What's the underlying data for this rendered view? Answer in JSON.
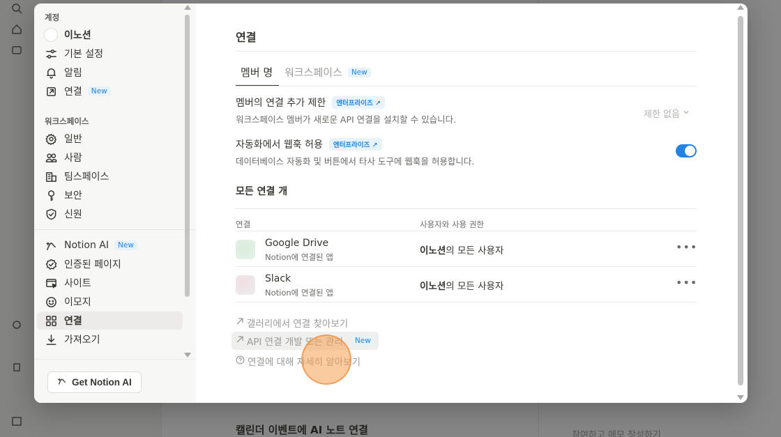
{
  "background": {
    "bottom_text": "캘린더 이벤트에 AI 노트 연결",
    "bottom_right_text": "참여하고 메모 작성하기"
  },
  "sidebar": {
    "account_section": "계정",
    "account_items": [
      {
        "label": "이노션",
        "icon": "avatar"
      },
      {
        "label": "기본 설정",
        "icon": "sliders-icon"
      },
      {
        "label": "알림",
        "icon": "bell-icon"
      },
      {
        "label": "연결",
        "icon": "arrow-out-icon",
        "badge": "New"
      }
    ],
    "workspace_section": "워크스페이스",
    "workspace_items": [
      {
        "label": "일반",
        "icon": "gear-icon"
      },
      {
        "label": "사람",
        "icon": "people-icon"
      },
      {
        "label": "팀스페이스",
        "icon": "building-icon"
      },
      {
        "label": "보안",
        "icon": "key-icon"
      },
      {
        "label": "신원",
        "icon": "shield-icon"
      }
    ],
    "feature_items": [
      {
        "label": "Notion AI",
        "icon": "ai-icon",
        "badge": "New"
      },
      {
        "label": "인증된 페이지",
        "icon": "verified-icon"
      },
      {
        "label": "사이트",
        "icon": "site-icon"
      },
      {
        "label": "이모지",
        "icon": "smile-icon"
      },
      {
        "label": "연결",
        "icon": "grid-icon",
        "active": true
      },
      {
        "label": "가져오기",
        "icon": "download-icon"
      }
    ],
    "get_ai_button": "Get Notion AI"
  },
  "main": {
    "title": "연결",
    "tabs": [
      {
        "label": "멤버 명",
        "selected": true
      },
      {
        "label": "워크스페이스",
        "badge": "New",
        "selected": false
      }
    ],
    "settings": [
      {
        "title": "멤버의 연결 추가 제한",
        "badge": "엔터프라이즈 ↗",
        "description": "워크스페이스 멤버가 새로운 API 연결을 설치할 수 있습니다.",
        "control": "select",
        "value": "제한 없음"
      },
      {
        "title": "자동화에서 웹훅 허용",
        "badge": "엔터프라이즈 ↗",
        "description": "데이터베이스 자동화 및 버튼에서 타사 도구에 웹훅을 허용합니다.",
        "control": "toggle",
        "value": true
      }
    ],
    "connections_heading": "모든 연결 개",
    "table": {
      "headers": [
        "연결",
        "사용자와 사용 권한"
      ],
      "rows": [
        {
          "name": "Google Drive",
          "sub": "Notion에 연결된 앱",
          "owner": "이노션",
          "perm_suffix": "의 모든 사용자",
          "more": "•••"
        },
        {
          "name": "Slack",
          "sub": "Notion에 연결된 앱",
          "owner": "이노션",
          "perm_suffix": "의 모든 사용자",
          "more": "•••"
        }
      ]
    },
    "links": [
      {
        "label": "갤러리에서 연결 찾아보기",
        "icon": "arrow-up-right-icon"
      },
      {
        "label": "API 연결 개발 또는 관리",
        "icon": "arrow-up-right-icon",
        "badge": "New"
      },
      {
        "label": "연결에 대해 자세히 알아보기",
        "icon": "help-icon"
      }
    ]
  },
  "colors": {
    "accent": "#2383e2",
    "badge_bg": "#e7f3f8"
  }
}
